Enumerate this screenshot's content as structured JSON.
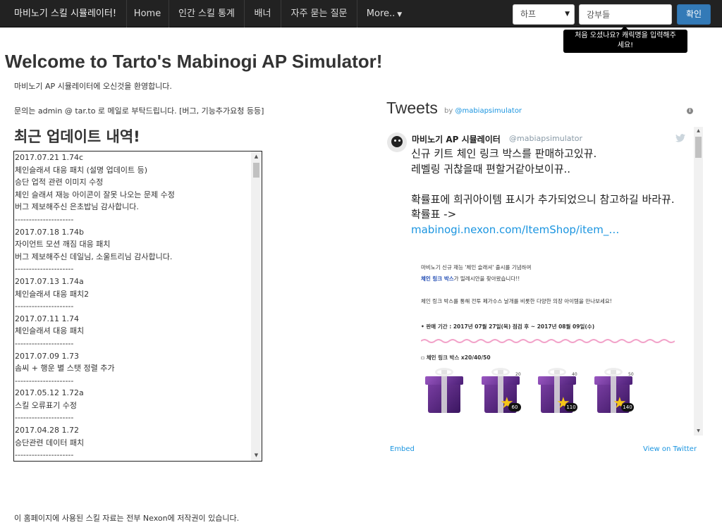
{
  "navbar": {
    "brand": "마비노기 스킬 시뮬레이터!",
    "items": [
      {
        "label": "Home"
      },
      {
        "label": "인간 스킬 통계"
      },
      {
        "label": "배너"
      },
      {
        "label": "자주 묻는 질문"
      },
      {
        "label": "More.."
      }
    ],
    "server_select": {
      "value": "하프"
    },
    "char_input": {
      "value": "강부들",
      "placeholder": ""
    },
    "confirm_label": "확인",
    "tooltip_lines": [
      "처음 오셨나요? 캐릭명을 입력해주",
      "세요!"
    ]
  },
  "main": {
    "title": "Welcome to Tarto's Mabinogi AP Simulator!",
    "welcome_text": "마비노기 AP 시뮬레이터에 오신것을 환영합니다.",
    "contact_text": "문의는 admin @ tar.to 로 메일로 부탁드립니다. [버그, 기능추가요청 등등]",
    "updates_heading": "최근 업데이트 내역!",
    "update_log": "2017.07.21 1.74c\n체인슬래셔 대응 패치 (설명 업데이트 등)\n승단 업적 관련 이미지 수정\n체인 슬래셔 재능 아이콘이 잘못 나오는 문제 수정\n버그 제보해주신 은초밥님 감사합니다.\n---------------------\n2017.07.18 1.74b\n자이언트 모션 깨짐 대응 패치\n버그 제보해주신 데일님, 소울트리님 감사합니다.\n---------------------\n2017.07.13 1.74a\n체인슬래셔 대응 패치2\n---------------------\n2017.07.11 1.74\n체인슬래셔 대응 패치\n---------------------\n2017.07.09 1.73\n솜씨 + 행운 별 스탯 정렬 추가\n---------------------\n2017.05.12 1.72a\n스킬 오류표기 수정\n---------------------\n2017.04.28 1.72\n승단관련 데이터 패치\n---------------------",
    "copyright": "이 홈페이지에 사용된 스킬 자료는 전부 Nexon에 저작권이 있습니다."
  },
  "twitter": {
    "title": "Tweets",
    "by_prefix": "by ",
    "by_handle": "@mabiapsimulator",
    "tweet": {
      "name": "마비노기 AP 시뮬레이터",
      "handle": "@mabiapsimulator",
      "line1": "신규 키트 체인 링크 박스를 판매하고있뀨.",
      "line2": "레벨링 귀찮을때 편할거같아보이뀨..",
      "line3": "확률표에 희귀아이템 표시가 추가되었으니 참고하길 바라뀨.",
      "line4": "확률표 ->",
      "link": "mabinogi.nexon.com/ItemShop/item_…"
    },
    "image": {
      "line1": "마비노기 신규 재능 '체인 슬래셔' 출시를 기념하여",
      "line2_bold": "체인 링크 박스",
      "line2_rest": "가 밀레시안을 찾아왔습니다!!",
      "line3": "체인 링크 박스를 통해 전투 페가수스 날개를 비롯한 다양한 의장 아이템을 만나보세요!",
      "line4": "• 판매 기간 : 2017년 07월 27일(목) 점검 후 ~ 2017년 08월 09일(수)",
      "line5": "▫ 체인 링크 박스 x20/40/50",
      "gifts": [
        {
          "top": "",
          "badge": ""
        },
        {
          "top": "20",
          "badge": "60"
        },
        {
          "top": "40",
          "badge": "110"
        },
        {
          "top": "50",
          "badge": "140"
        }
      ]
    },
    "embed_label": "Embed",
    "view_label": "View on Twitter"
  },
  "colors": {
    "navbar_bg": "#222222",
    "primary_button": "#337ab7",
    "twitter_link": "#1b95e0"
  }
}
